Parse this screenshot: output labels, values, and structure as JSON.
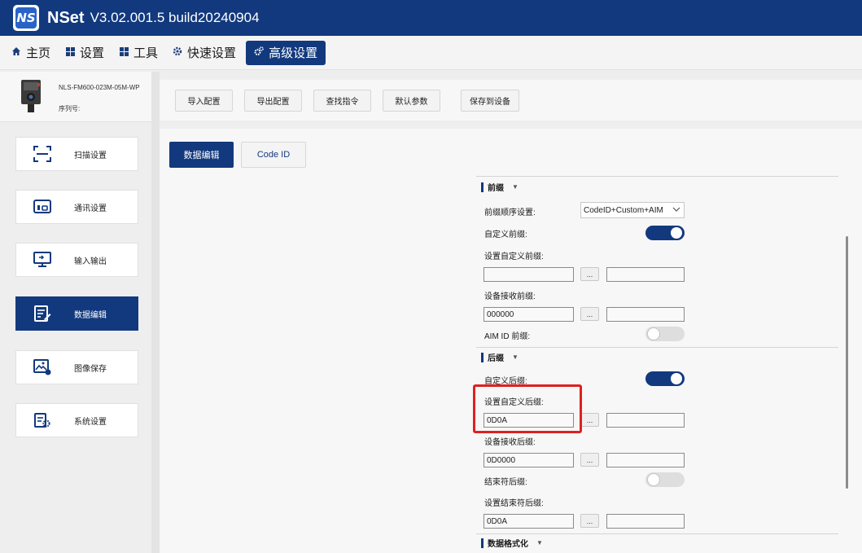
{
  "app": {
    "logo_text": "NS",
    "name": "NSet",
    "version": "V3.02.001.5 build20240904"
  },
  "menu": [
    {
      "label": "主页",
      "icon": "home-icon"
    },
    {
      "label": "设置",
      "icon": "grid-icon"
    },
    {
      "label": "工具",
      "icon": "grid-icon"
    },
    {
      "label": "快速设置",
      "icon": "gear-icon"
    },
    {
      "label": "高级设置",
      "icon": "gears-icon",
      "active": true
    }
  ],
  "device": {
    "model": "NLS-FM600-023M-05M-WP",
    "serial_label": "序列号:"
  },
  "sidebar": {
    "items": [
      {
        "label": "扫描设置",
        "icon": "scan-icon"
      },
      {
        "label": "通讯设置",
        "icon": "communication-icon"
      },
      {
        "label": "输入输出",
        "icon": "monitor-icon"
      },
      {
        "label": "数据编辑",
        "icon": "data-edit-icon",
        "active": true
      },
      {
        "label": "图像保存",
        "icon": "image-save-icon"
      },
      {
        "label": "系统设置",
        "icon": "system-settings-icon"
      }
    ]
  },
  "toolbar": {
    "import": "导入配置",
    "export": "导出配置",
    "find": "查找指令",
    "defaults": "默认参数",
    "save": "保存到设备"
  },
  "tabs": {
    "data_edit": "数据编辑",
    "code_id": "Code ID"
  },
  "prefix": {
    "title": "前缀",
    "order_label": "前缀顺序设置:",
    "order_value": "CodeID+Custom+AIM",
    "custom_label": "自定义前缀:",
    "custom_on": true,
    "set_custom_label": "设置自定义前缀:",
    "set_custom_value": "",
    "device_recv_label": "设备接收前缀:",
    "device_recv_value": "000000",
    "aim_label": "AIM ID 前缀:",
    "aim_on": false
  },
  "suffix": {
    "title": "后缀",
    "custom_label": "自定义后缀:",
    "custom_on": true,
    "set_custom_label": "设置自定义后缀:",
    "set_custom_value": "0D0A",
    "device_recv_label": "设备接收后缀:",
    "device_recv_value": "0D0000",
    "terminator_label": "结束符后缀:",
    "terminator_on": false,
    "set_terminator_label": "设置结束符后缀:",
    "set_terminator_value": "0D0A"
  },
  "data_format": {
    "title": "数据格式化"
  },
  "dots_label": "...",
  "colors": {
    "primary": "#12397e",
    "highlight": "#e02020"
  }
}
